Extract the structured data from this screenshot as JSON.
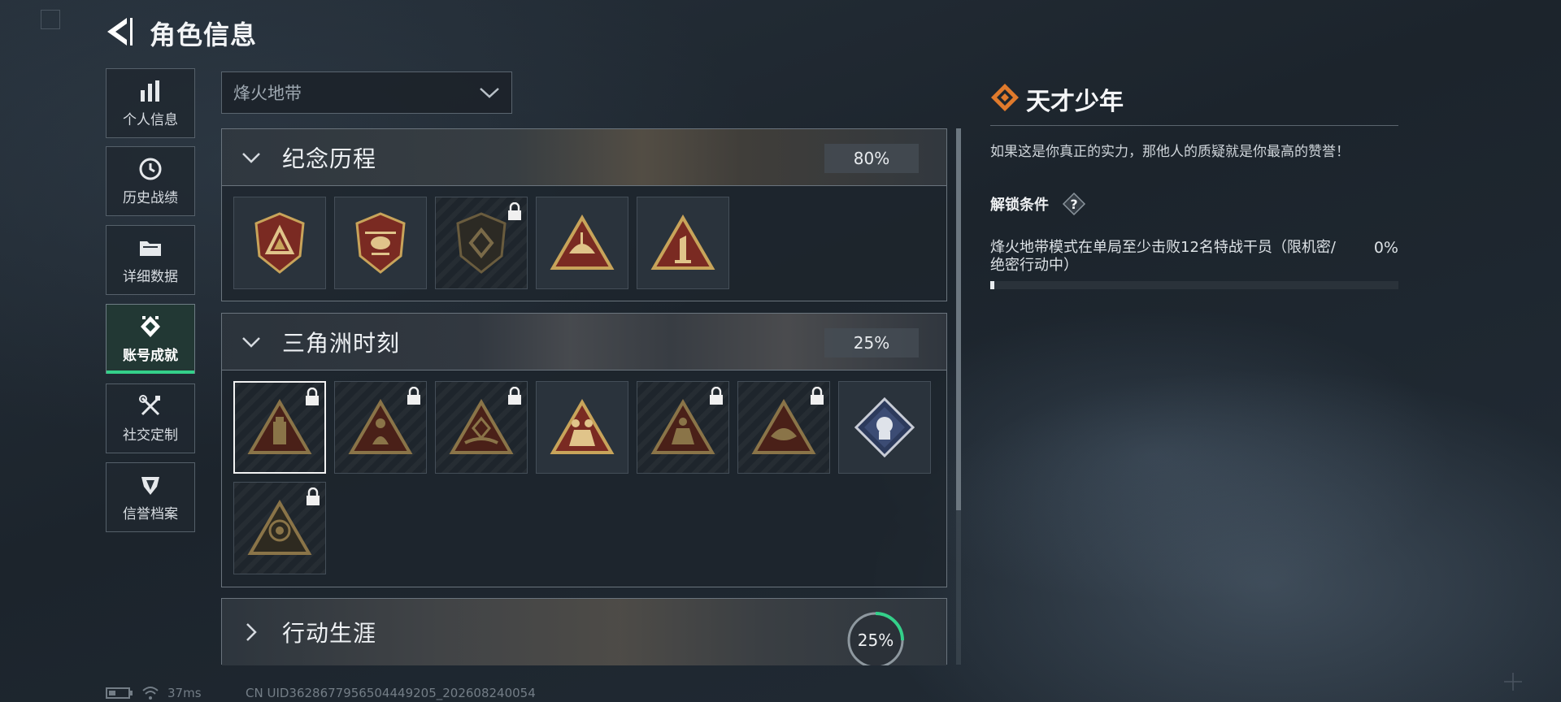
{
  "header": {
    "title": "角色信息"
  },
  "nav": {
    "items": [
      {
        "label": "个人信息",
        "icon": "bar-chart-icon"
      },
      {
        "label": "历史战绩",
        "icon": "clock-icon"
      },
      {
        "label": "详细数据",
        "icon": "folder-icon"
      },
      {
        "label": "账号成就",
        "icon": "achievement-icon",
        "active": true
      },
      {
        "label": "社交定制",
        "icon": "tools-icon"
      },
      {
        "label": "信誉档案",
        "icon": "shield-icon"
      }
    ]
  },
  "mode_select": {
    "value": "烽火地带"
  },
  "sections": [
    {
      "title": "纪念历程",
      "percent": "80%",
      "expanded": true,
      "badges": [
        {
          "icon": "shield-triangle-emblem",
          "locked": false
        },
        {
          "icon": "helicopter-emblem",
          "locked": false
        },
        {
          "icon": "dark-emblem",
          "locked": true
        },
        {
          "icon": "ship-emblem",
          "locked": false
        },
        {
          "icon": "number-one-emblem",
          "locked": false
        }
      ]
    },
    {
      "title": "三角洲时刻",
      "percent": "25%",
      "expanded": true,
      "badges": [
        {
          "icon": "usb-triangle-emblem",
          "locked": true,
          "selected": true
        },
        {
          "icon": "mermaid-triangle-emblem",
          "locked": true
        },
        {
          "icon": "hands-triangle-emblem",
          "locked": true
        },
        {
          "icon": "soldiers-triangle-emblem",
          "locked": false
        },
        {
          "icon": "team-triangle-emblem",
          "locked": true
        },
        {
          "icon": "fish-triangle-emblem",
          "locked": true
        },
        {
          "icon": "fist-diamond-emblem",
          "locked": false
        },
        {
          "icon": "hooded-triangle-emblem",
          "locked": true
        }
      ]
    },
    {
      "title": "行动生涯",
      "percent": "25%",
      "progress": 0.25,
      "expanded": false
    }
  ],
  "detail": {
    "title": "天才少年",
    "description": "如果这是你真正的实力，那他人的质疑就是你最高的赞誉！",
    "unlock_label": "解锁条件",
    "condition": "烽火地带模式在单局至少击败12名特战干员（限机密/绝密行动中）",
    "percent": "0%",
    "progress": 0.01
  },
  "status": {
    "ping": "37ms",
    "uid": "CN UID3628677956504449205_202608240054"
  },
  "colors": {
    "accent_green": "#34d08a",
    "badge_gold": "#c8a45a",
    "badge_red": "#7a2a22",
    "detail_orange": "#e07a2c"
  }
}
